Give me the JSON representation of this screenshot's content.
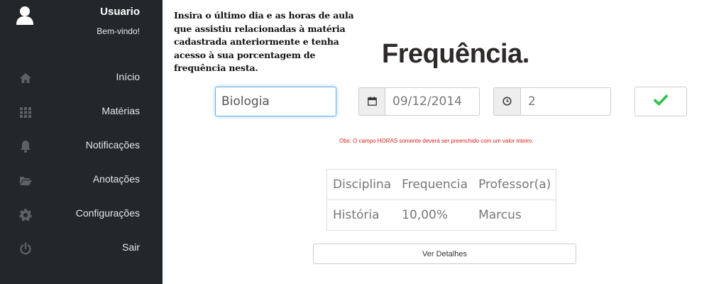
{
  "sidebar": {
    "user": {
      "name": "Usuario",
      "welcome": "Bem-vindo!",
      "icon": "user-icon"
    },
    "items": [
      {
        "label": "Início",
        "icon": "home-icon"
      },
      {
        "label": "Matérias",
        "icon": "grid-icon"
      },
      {
        "label": "Notificações",
        "icon": "bell-icon"
      },
      {
        "label": "Anotações",
        "icon": "folder-open-icon"
      },
      {
        "label": "Configurações",
        "icon": "gear-icon"
      },
      {
        "label": "Sair",
        "icon": "power-icon"
      }
    ]
  },
  "main": {
    "instructions": "Insira o último dia e as horas de aula que assistiu relacionadas à matéria cadastrada anteriormente e tenha acesso à sua porcentagem de frequência nesta.",
    "title": "Frequência.",
    "form": {
      "discipline_value": "Biologia",
      "date_icon": "calendar-icon",
      "date_value": "09/12/2014",
      "hours_icon": "clock-icon",
      "hours_value": "2",
      "submit_icon": "check-icon",
      "check_color": "#2ec24a"
    },
    "note": "Obs: O campo HORAS somente deverá ser preenchido com um valor inteiro.",
    "table": {
      "headers": [
        "Disciplina",
        "Frequencia",
        "Professor(a)"
      ],
      "rows": [
        [
          "História",
          "10,00%",
          "Marcus"
        ]
      ]
    },
    "details_button": "Ver Detalhes"
  }
}
